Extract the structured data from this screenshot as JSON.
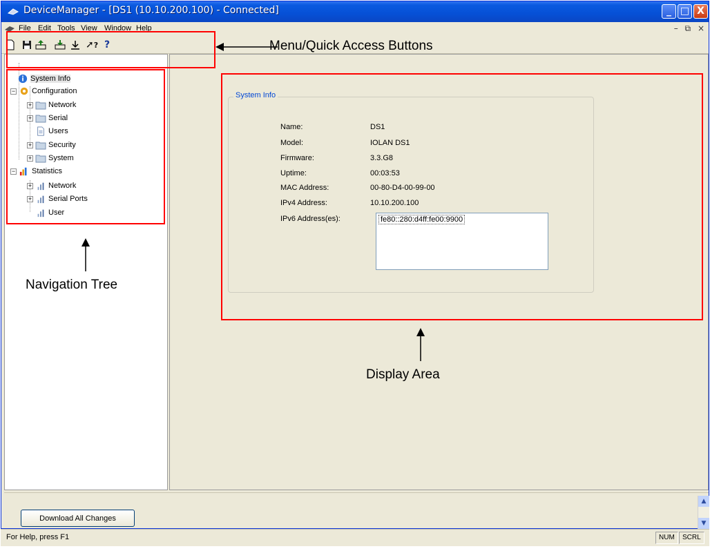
{
  "window": {
    "title": "DeviceManager - [DS1 (10.10.200.100) - Connected]",
    "title_buttons": [
      "_",
      "□",
      "X"
    ]
  },
  "menu": {
    "items": [
      "File",
      "Edit",
      "Tools",
      "View",
      "Window",
      "Help"
    ],
    "mdi_controls": "_ ♬ ×"
  },
  "toolbar": {
    "buttons": [
      "new-icon",
      "save-icon",
      "upload-icon",
      "download-icon",
      "export-icon",
      "whats-this-icon",
      "help-icon"
    ],
    "help_glyph": "?",
    "whats_this_glyph": "?"
  },
  "tree": {
    "system_info": "System Info",
    "configuration": "Configuration",
    "network": "Network",
    "serial": "Serial",
    "users": "Users",
    "security": "Security",
    "system": "System",
    "statistics": "Statistics",
    "stat_network": "Network",
    "stat_serial_ports": "Serial Ports",
    "stat_user": "User"
  },
  "system_info": {
    "group_title": "System Info",
    "fields": [
      {
        "label": "Name:",
        "value": "DS1"
      },
      {
        "label": "Model:",
        "value": "IOLAN DS1"
      },
      {
        "label": "Firmware:",
        "value": "3.3.G8"
      },
      {
        "label": "Uptime:",
        "value": "00:03:53"
      },
      {
        "label": "MAC Address:",
        "value": "00-80-D4-00-99-00"
      },
      {
        "label": "IPv4 Address:",
        "value": "10.10.200.100"
      },
      {
        "label": "IPv6 Address(es):",
        "value": "fe80::280:d4ff:fe00:9900"
      }
    ]
  },
  "bottom": {
    "download_button": "Download All Changes"
  },
  "status": {
    "help_text": "For Help, press F1",
    "num": "NUM",
    "scrl": "SCRL"
  },
  "annotations": {
    "menu_quick_access": "Menu/Quick Access Buttons",
    "navigation_tree": "Navigation Tree",
    "display_area": "Display Area"
  },
  "colors": {
    "annotation_red": "#ff0000",
    "title_blue": "#0a5ae0",
    "group_title_blue": "#0046d5"
  }
}
